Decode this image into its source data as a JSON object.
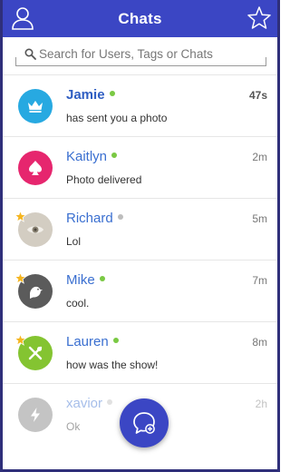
{
  "header": {
    "title": "Chats"
  },
  "search": {
    "placeholder": "Search for Users, Tags or Chats"
  },
  "chats": [
    {
      "name": "Jamie",
      "message": "has sent you a photo",
      "time": "47s",
      "status": "online",
      "favorite": false,
      "unread": true,
      "avatar_icon": "crown-icon",
      "avatar_color": "#27a9e1"
    },
    {
      "name": "Kaitlyn",
      "message": "Photo delivered",
      "time": "2m",
      "status": "online",
      "favorite": false,
      "unread": false,
      "avatar_icon": "spade-icon",
      "avatar_color": "#e6266e"
    },
    {
      "name": "Richard",
      "message": "Lol",
      "time": "5m",
      "status": "offline",
      "favorite": true,
      "unread": false,
      "avatar_icon": "eye-icon",
      "avatar_color": "#c9c3b8"
    },
    {
      "name": "Mike",
      "message": "cool.",
      "time": "7m",
      "status": "online",
      "favorite": true,
      "unread": false,
      "avatar_icon": "bird-icon",
      "avatar_color": "#5b5b5b"
    },
    {
      "name": "Lauren",
      "message": "how was the show!",
      "time": "8m",
      "status": "online",
      "favorite": true,
      "unread": false,
      "avatar_icon": "utensils-icon",
      "avatar_color": "#84c431"
    },
    {
      "name": "xavior",
      "message": "Ok",
      "time": "2h",
      "status": "offline",
      "favorite": false,
      "unread": false,
      "avatar_icon": "lightning-icon",
      "avatar_color": "#8a8a8a"
    }
  ],
  "colors": {
    "accent": "#3b46c4",
    "online": "#7ac943",
    "offline": "#bdbdbd",
    "favorite": "#f5b51f"
  },
  "fab": {
    "icon": "new-chat-icon"
  }
}
